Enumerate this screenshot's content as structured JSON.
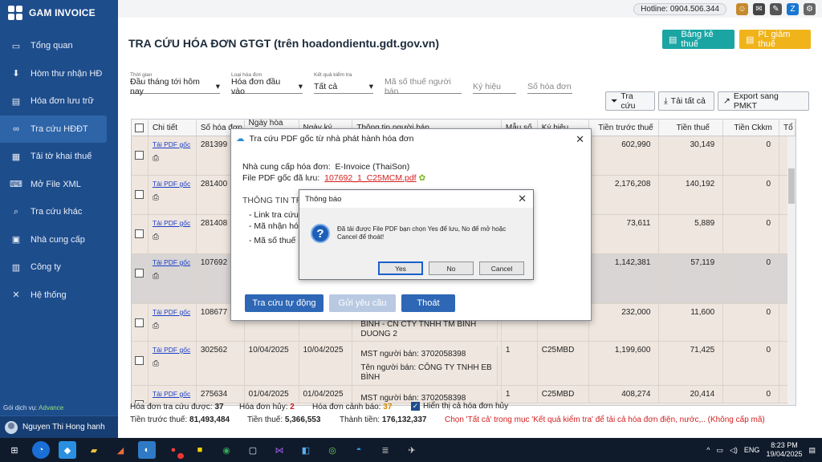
{
  "app": {
    "name": "GAM INVOICE"
  },
  "sidebar": {
    "items": [
      {
        "label": "Tổng quan"
      },
      {
        "label": "Hòm thư nhận HĐ"
      },
      {
        "label": "Hóa đơn lưu trữ"
      },
      {
        "label": "Tra cứu HĐĐT"
      },
      {
        "label": "Tải tờ khai thuế"
      },
      {
        "label": "Mở File XML"
      },
      {
        "label": "Tra cứu khác"
      },
      {
        "label": "Nhà cung cấp"
      },
      {
        "label": "Công ty"
      },
      {
        "label": "Hệ thống"
      }
    ],
    "service_label": "Gói dịch vụ:",
    "service_value": "Advance",
    "user": "Nguyen Thi Hong hanh"
  },
  "topbar": {
    "hotline": "Hotline: 0904.506.344"
  },
  "page": {
    "title": "TRA CỨU HÓA ĐƠN GTGT (trên hoadondientu.gdt.gov.vn)",
    "btn_bang_ke": "Bảng kê thuế",
    "btn_pl_giam": "PL giảm thuế"
  },
  "filters": {
    "thoi_gian_label": "Thời gian",
    "thoi_gian_value": "Đầu tháng tới hôm nay",
    "loai_label": "Loại hóa đơn",
    "loai_value": "Hóa đơn đầu vào",
    "kq_label": "Kết quả kiểm tra",
    "kq_value": "Tất cả",
    "mst_placeholder": "Mã số thuế người bán",
    "kyhieu_placeholder": "Ký hiệu",
    "sohd_placeholder": "Số hóa đơn"
  },
  "toolbar": {
    "tra_cuu": "Tra cứu",
    "tai_tat_ca": "Tải tất cả",
    "export": "Export sang PMKT"
  },
  "table": {
    "headers": [
      "Chi tiết",
      "Số hóa đơn",
      "Ngày hóa đơn",
      "Ngày ký",
      "Thông tin người bán",
      "Mẫu số",
      "Ký hiệu",
      "Tiền trước thuế",
      "Tiền thuế",
      "Tiền Ckkm",
      "Tổ"
    ],
    "link_label": "Tải PDF gốc",
    "rows": [
      {
        "so": "281399",
        "ngay": "04/04/2025",
        "ky": "04/04/2025",
        "nb1": "MST người bán: 3702058398",
        "nb2": "",
        "nb3": "",
        "mau": "1",
        "kh": "C25MBD",
        "truoc": "602,990",
        "thue": "30,149",
        "ck": "0"
      },
      {
        "so": "281400",
        "ngay": "",
        "ky": "",
        "nb1": "",
        "nb2": "",
        "nb3": "",
        "mau": "",
        "kh": "",
        "truoc": "2,176,208",
        "thue": "140,192",
        "ck": "0"
      },
      {
        "so": "281408",
        "ngay": "",
        "ky": "",
        "nb1": "",
        "nb2": "",
        "nb3": "",
        "mau": "",
        "kh": "",
        "truoc": "73,611",
        "thue": "5,889",
        "ck": "0"
      },
      {
        "so": "107692",
        "ngay": "",
        "ky": "",
        "nb1": "",
        "nb2": "",
        "nb3": "",
        "mau": "",
        "kh": "",
        "truoc": "1,142,381",
        "thue": "57,119",
        "ck": "0"
      },
      {
        "so": "108677",
        "ngay": "",
        "ky": "",
        "nb1": "",
        "nb2": "",
        "nb3": "BINH - CN CTY TNHH TM BINH DUONG 2",
        "mau": "",
        "kh": "",
        "truoc": "232,000",
        "thue": "11,600",
        "ck": "0"
      },
      {
        "so": "302562",
        "ngay": "10/04/2025",
        "ky": "10/04/2025",
        "nb1": "MST người bán: 3702058398",
        "nb2": "Tên người bán: CÔNG TY TNHH EB BÌNH",
        "nb3": "DƯƠNG",
        "mau": "1",
        "kh": "C25MBD",
        "truoc": "1,199,600",
        "thue": "71,425",
        "ck": "0"
      },
      {
        "so": "275634",
        "ngay": "01/04/2025",
        "ky": "01/04/2025",
        "nb1": "MST người bán: 3702058398",
        "nb2": "",
        "nb3": "",
        "mau": "1",
        "kh": "C25MBD",
        "truoc": "408,274",
        "thue": "20,414",
        "ck": "0"
      }
    ]
  },
  "stats": {
    "tra_cuu_label": "Hóa đơn tra cứu được:",
    "tra_cuu": "37",
    "huy_label": "Hóa đơn hủy:",
    "huy": "2",
    "canh_bao_label": "Hóa đơn cảnh báo:",
    "canh_bao": "37",
    "hien_thi_huy": "Hiển thị cả hóa đơn hủy",
    "truoc_thue_label": "Tiền trước thuế:",
    "truoc_thue": "81,493,484",
    "tien_thue_label": "Tiền thuế:",
    "tien_thue": "5,366,553",
    "thanh_tien_label": "Thành tiền:",
    "thanh_tien": "176,132,337",
    "note": "Chọn 'Tất cả' trong mục 'Kết quả kiểm tra' để tải cả hóa đơn điện, nước,.. (Không cấp mã)"
  },
  "dialog_pdf": {
    "title": "Tra cứu PDF gốc từ nhà phát hành hóa đơn",
    "ncc_label": "Nhà cung cấp hóa đơn:",
    "ncc_value": "E-Invoice (ThaiSon)",
    "file_label": "File PDF gốc đã lưu:",
    "file_value": "107692_1_C25MCM.pdf",
    "info_title": "THÔNG TIN TRA",
    "line1": "- Link tra cứu:",
    "line2": "- Mã nhận hóa",
    "line3": "- Mã số thuế ng",
    "btn_auto": "Tra cứu tự động",
    "btn_gui": "Gửi yêu cầu",
    "btn_thoat": "Thoát"
  },
  "dialog_msg": {
    "title": "Thông báo",
    "line1": "Đã tải được File PDF bạn chọn Yes để lưu, No để mở hoặc",
    "line2": "Cancel để thoát!",
    "yes": "Yes",
    "no": "No",
    "cancel": "Cancel"
  },
  "taskbar": {
    "lang": "ENG",
    "time": "8:23 PM",
    "date": "19/04/2025",
    "badge": "5"
  },
  "colors": {
    "sidebar": "#1e4d8c",
    "teal": "#1aa5a3",
    "amber": "#f0b31a",
    "blue_btn": "#2d67b5"
  }
}
